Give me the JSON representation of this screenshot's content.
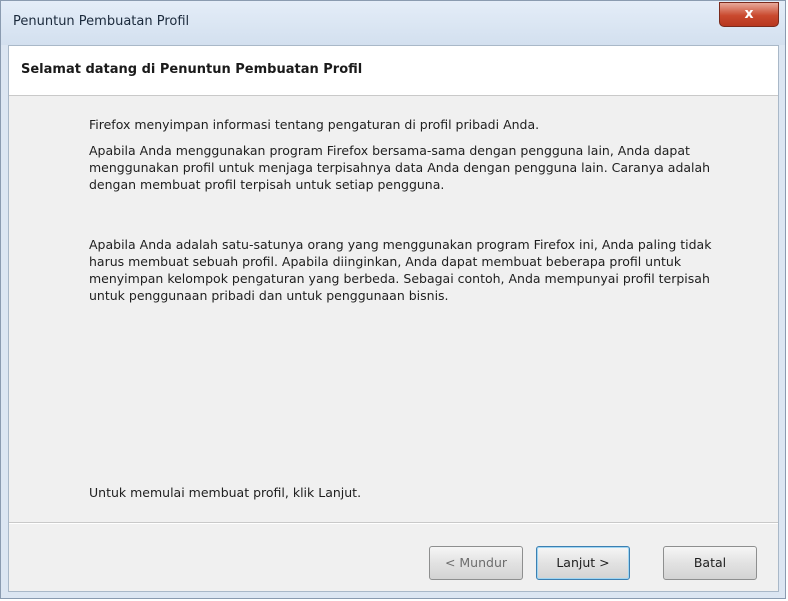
{
  "window": {
    "title": "Penuntun Pembuatan Profil",
    "close_label": "x"
  },
  "header": {
    "title": "Selamat datang di Penuntun Pembuatan Profil"
  },
  "content": {
    "paragraph_1": "Firefox menyimpan informasi tentang pengaturan di profil pribadi Anda.",
    "paragraph_2": "Apabila Anda menggunakan program Firefox bersama-sama dengan pengguna lain, Anda dapat menggunakan profil untuk menjaga terpisahnya data Anda dengan pengguna lain. Caranya adalah dengan membuat profil terpisah untuk setiap pengguna.",
    "paragraph_3": "Apabila Anda adalah satu-satunya orang yang menggunakan program Firefox ini, Anda paling tidak harus membuat sebuah profil. Apabila diinginkan, Anda dapat membuat beberapa profil untuk menyimpan kelompok pengaturan yang berbeda. Sebagai contoh, Anda mempunyai profil terpisah untuk penggunaan pribadi dan untuk penggunaan bisnis.",
    "instruction": "Untuk memulai membuat profil, klik Lanjut."
  },
  "buttons": {
    "back": "< Mundur",
    "next": "Lanjut >",
    "cancel": "Batal"
  }
}
